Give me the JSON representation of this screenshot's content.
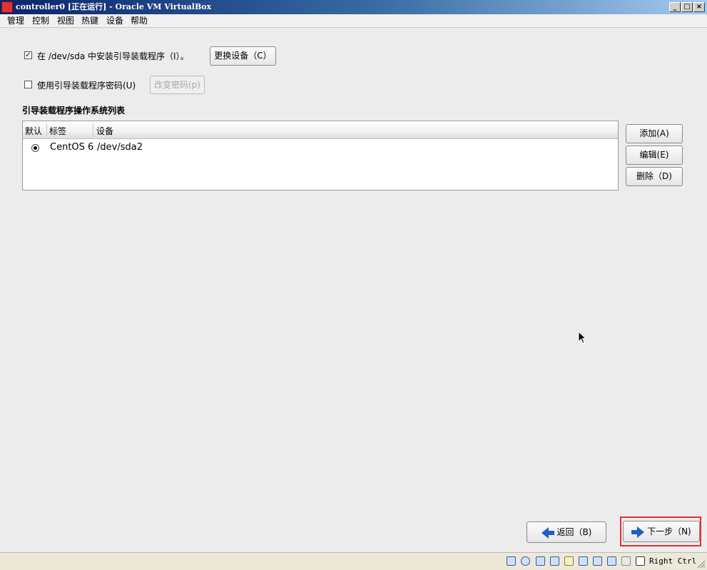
{
  "window": {
    "title": "controller0 [正在运行] - Oracle VM VirtualBox",
    "minimize": "_",
    "maximize": "□",
    "close": "×"
  },
  "menu": [
    "管理",
    "控制",
    "视图",
    "热键",
    "设备",
    "帮助"
  ],
  "bootloader": {
    "install_checkbox_label": "在 /dev/sda 中安装引导装载程序（I）。",
    "install_checked": true,
    "change_device_button": "更换设备（C）",
    "password_checkbox_label": "使用引导装载程序密码(U)",
    "password_checked": false,
    "change_password_button": "改变密码(p)",
    "list_title": "引导装载程序操作系统列表",
    "columns": [
      "默认",
      "标签",
      "设备"
    ],
    "rows": [
      {
        "default": true,
        "label": "CentOS 6",
        "device": "/dev/sda2"
      }
    ],
    "add_button": "添加(A)",
    "edit_button": "编辑(E)",
    "delete_button": "删除（D)"
  },
  "nav": {
    "back_button": "返回（B)",
    "next_button": "下一步（N)"
  },
  "statusbar": {
    "host_key": "Right Ctrl",
    "icons": [
      "hard-disk-icon",
      "optical-drive-icon",
      "network-icon",
      "usb-icon",
      "shared-folder-icon",
      "display-icon",
      "video-capture-icon",
      "cpu-icon",
      "mouse-integration-icon",
      "keyboard-capture-icon"
    ]
  },
  "colors": {
    "highlight_border": "#e0332e",
    "arrow_blue": "#1f5fbf"
  }
}
